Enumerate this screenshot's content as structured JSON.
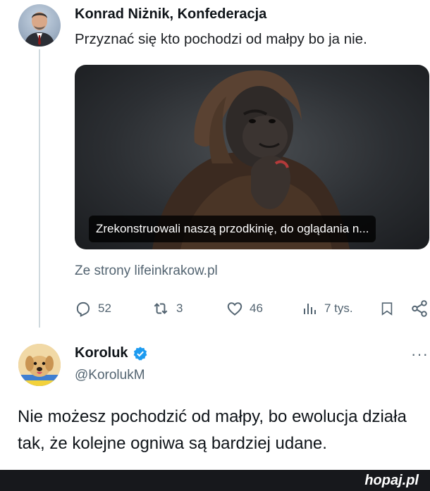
{
  "tweet1": {
    "author": "Konrad Niżnik, Konfederacja",
    "text": "Przyznać się kto pochodzi od małpy bo ja nie.",
    "media_caption": "Zrekonstruowali naszą przodkinię, do oglądania n...",
    "source": "Ze strony lifeinkrakow.pl",
    "actions": {
      "replies": "52",
      "retweets": "3",
      "likes": "46",
      "views": "7 tys."
    }
  },
  "tweet2": {
    "author": "Koroluk",
    "handle": "@KorolukM",
    "more": "···",
    "text": "Nie możesz pochodzić od małpy, bo ewolucja działa tak, że kolejne ogniwa są bardziej udane."
  },
  "footer": {
    "brand": "hopaj.pl"
  },
  "colors": {
    "verified": "#1d9bf0",
    "secondary_text": "#536471",
    "footer_bg": "#17181c"
  },
  "icons": [
    "reply-icon",
    "retweet-icon",
    "like-icon",
    "views-icon",
    "bookmark-icon",
    "share-icon",
    "verified-badge-icon",
    "more-options-icon"
  ]
}
